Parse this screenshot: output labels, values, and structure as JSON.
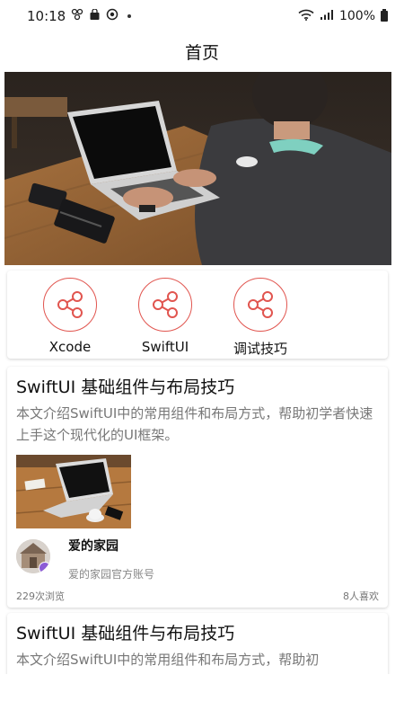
{
  "status_bar": {
    "time": "10:18",
    "battery": "100%"
  },
  "header": {
    "title": "首页"
  },
  "banner": {
    "image": "person typing on laptop at wooden desk"
  },
  "categories": [
    {
      "label": "Xcode",
      "icon": "share-icon"
    },
    {
      "label": "SwiftUI",
      "icon": "share-icon"
    },
    {
      "label": "调试技巧",
      "icon": "share-icon"
    }
  ],
  "articles": [
    {
      "title": "SwiftUI 基础组件与布局技巧",
      "summary": "本文介绍SwiftUI中的常用组件和布局方式，帮助初学者快速上手这个现代化的UI框架。",
      "author_name": "爱的家园",
      "author_desc": "爱的家园官方账号",
      "views": "229次浏览",
      "likes": "8人喜欢"
    },
    {
      "title": "SwiftUI 基础组件与布局技巧",
      "summary": "本文介绍SwiftUI中的常用组件和布局方式，帮助初"
    }
  ],
  "colors": {
    "accent": "#e1554f"
  }
}
